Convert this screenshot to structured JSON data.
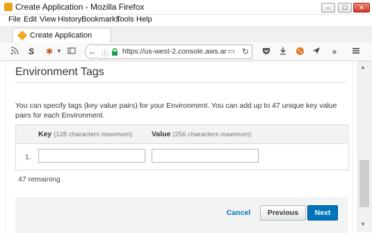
{
  "window": {
    "title": "Create Application - Mozilla Firefox",
    "minimize": "–",
    "maximize": "☐",
    "close": "✕"
  },
  "menu": {
    "items": [
      "File",
      "Edit",
      "View",
      "History",
      "Bookmarks",
      "Tools",
      "Help"
    ]
  },
  "tab": {
    "label": "Create Application"
  },
  "toolbar": {
    "url": "https://us-west-2.console.aws.ar",
    "more": "»"
  },
  "section": {
    "title": "Environment Tags",
    "description": "You can specify tags (key value pairs) for your Environment. You can add up to 47 unique key value pairs for each Environment."
  },
  "table": {
    "key_header": "Key",
    "key_hint": "(128 characters maximum)",
    "value_header": "Value",
    "value_hint": "(256 characters maximum)",
    "rows": [
      {
        "index": "1.",
        "key": "",
        "value": ""
      }
    ]
  },
  "remaining": "47 remaining",
  "footer": {
    "cancel": "Cancel",
    "previous": "Previous",
    "next": "Next"
  },
  "colors": {
    "primary": "#0073bb",
    "link": "#0073bb",
    "firefox_accent": "#e8a317"
  }
}
